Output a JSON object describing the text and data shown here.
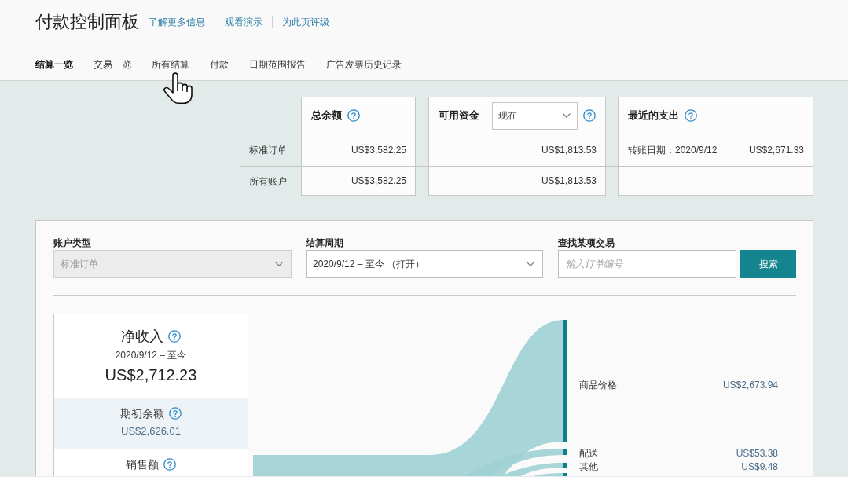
{
  "header": {
    "title": "付款控制面板",
    "links": [
      "了解更多信息",
      "观看演示",
      "为此页评级"
    ]
  },
  "tabs": [
    {
      "label": "结算一览",
      "selected": true
    },
    {
      "label": "交易一览",
      "selected": false
    },
    {
      "label": "所有结算",
      "selected": false
    },
    {
      "label": "付款",
      "selected": false
    },
    {
      "label": "日期范围报告",
      "selected": false
    },
    {
      "label": "广告发票历史记录",
      "selected": false
    }
  ],
  "summary": {
    "row_labels": [
      "标准订单",
      "所有账户"
    ],
    "boxes": [
      {
        "kind": "plain",
        "title": "总余额",
        "rows": [
          {
            "amount": "US$3,582.25"
          },
          {
            "amount": "US$3,582.25"
          }
        ]
      },
      {
        "kind": "dropdown",
        "title": "可用资金",
        "selection": "现在",
        "rows": [
          {
            "amount": "US$1,813.53"
          },
          {
            "amount": "US$1,813.53"
          }
        ]
      },
      {
        "kind": "plain",
        "title": "最近的支出",
        "rows": [
          {
            "label": "转账日期：2020/9/12",
            "amount": "US$2,671.33"
          }
        ]
      }
    ]
  },
  "filters": [
    {
      "kind": "select",
      "label": "账户类型",
      "value": "标准订单",
      "disabled": true
    },
    {
      "kind": "select",
      "label": "结算周期",
      "value": "2020/9/12 – 至今 （打开）",
      "disabled": false
    },
    {
      "kind": "search",
      "label": "查找某项交易",
      "placeholder": "输入订单编号",
      "button": "搜索"
    }
  ],
  "net_income": {
    "title": "净收入",
    "period": "2020/9/12 – 至今",
    "amount": "US$2,712.23",
    "sections": [
      {
        "title": "期初余额",
        "amount": "US$2,626.01",
        "selected": true
      },
      {
        "title": "销售额",
        "selected": false
      }
    ]
  },
  "breakdown": [
    {
      "label": "商品价格",
      "amount": "US$2,673.94"
    },
    {
      "label": "配送",
      "amount": "US$53.38"
    },
    {
      "label": "其他",
      "amount": "US$9.48"
    }
  ]
}
